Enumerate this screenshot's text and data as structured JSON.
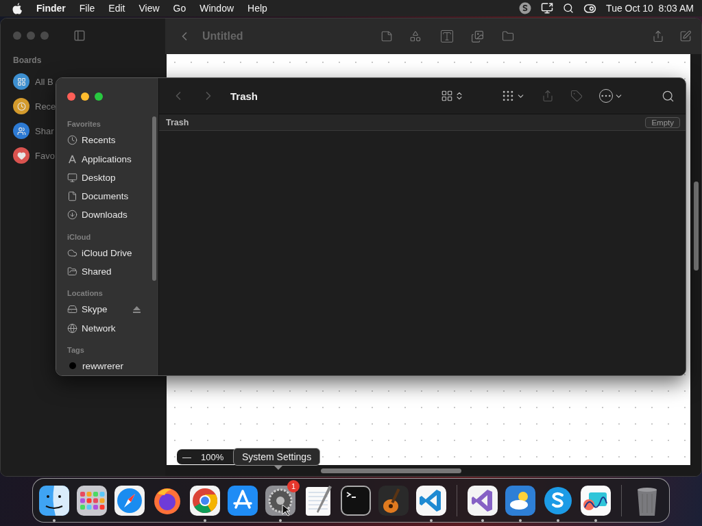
{
  "menu_bar": {
    "app": "Finder",
    "menus": [
      "File",
      "Edit",
      "View",
      "Go",
      "Window",
      "Help"
    ],
    "clock": "Tue Oct 10  8:03 AM"
  },
  "freeform": {
    "title": "Untitled",
    "sidebar_header": "Boards",
    "boards": [
      {
        "label": "All B",
        "kind": "all",
        "color": "#3d8fd0"
      },
      {
        "label": "Rece",
        "kind": "recent",
        "color": "#d39a2c"
      },
      {
        "label": "Shar",
        "kind": "shared",
        "color": "#2d7ad3"
      },
      {
        "label": "Favo",
        "kind": "favorites",
        "color": "#d9534f"
      }
    ],
    "zoom": {
      "minus": "—",
      "value": "100%"
    }
  },
  "finder": {
    "title": "Trash",
    "path": "Trash",
    "empty_button": "Empty",
    "nav": [
      {
        "kind": "back",
        "disabled": true
      },
      {
        "kind": "forward",
        "disabled": true
      }
    ],
    "tools": [
      {
        "kind": "view",
        "disabled": false
      },
      {
        "kind": "group",
        "disabled": false
      },
      {
        "kind": "share",
        "disabled": true
      },
      {
        "kind": "tag",
        "disabled": true
      },
      {
        "kind": "more",
        "disabled": false
      },
      {
        "kind": "search",
        "disabled": false
      }
    ],
    "sidebar": [
      {
        "header": "Favorites",
        "items": [
          {
            "label": "Recents",
            "kind": "clock"
          },
          {
            "label": "Applications",
            "kind": "apps"
          },
          {
            "label": "Desktop",
            "kind": "desktop"
          },
          {
            "label": "Documents",
            "kind": "document"
          },
          {
            "label": "Downloads",
            "kind": "download"
          }
        ]
      },
      {
        "header": "iCloud",
        "items": [
          {
            "label": "iCloud Drive",
            "kind": "cloud"
          },
          {
            "label": "Shared",
            "kind": "shared"
          }
        ]
      },
      {
        "header": "Locations",
        "items": [
          {
            "label": "Skype",
            "kind": "disk",
            "eject": true
          },
          {
            "label": "Network",
            "kind": "globe",
            "eject": false
          }
        ]
      },
      {
        "header": "Tags",
        "items": [
          {
            "label": "rewwrerer",
            "kind": "tag",
            "color": "#000000"
          }
        ]
      }
    ]
  },
  "tooltip": "System Settings",
  "dock": {
    "sections": [
      [
        {
          "kind": "finder",
          "running": true
        },
        {
          "kind": "launchpad",
          "running": false
        },
        {
          "kind": "safari",
          "running": false
        },
        {
          "kind": "firefox",
          "running": false
        },
        {
          "kind": "chrome",
          "running": true
        },
        {
          "kind": "appstore",
          "running": false
        },
        {
          "kind": "settings",
          "running": true,
          "badge": "1"
        },
        {
          "kind": "textedit",
          "running": false
        },
        {
          "kind": "terminal",
          "running": false
        },
        {
          "kind": "garageband",
          "running": false
        },
        {
          "kind": "vscode",
          "running": true
        }
      ],
      [
        {
          "kind": "visualstudio",
          "running": true
        },
        {
          "kind": "weather",
          "running": true
        },
        {
          "kind": "skype",
          "running": true
        },
        {
          "kind": "freeform",
          "running": true
        }
      ],
      [
        {
          "kind": "trash",
          "running": false
        }
      ]
    ]
  }
}
